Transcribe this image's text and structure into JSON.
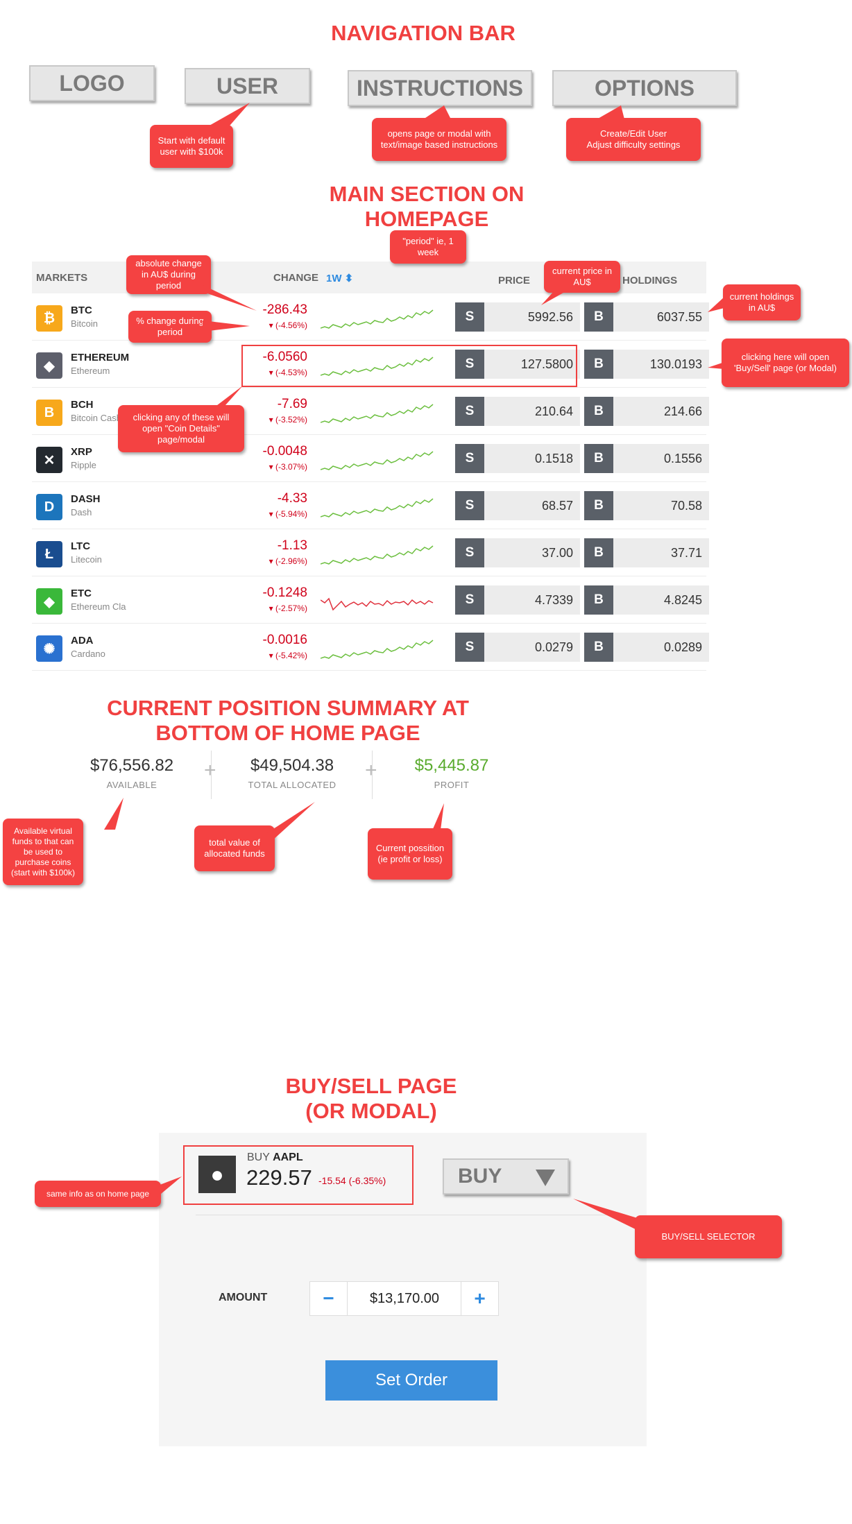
{
  "headings": {
    "nav": "NAVIGATION BAR",
    "main": "MAIN SECTION ON\nHOMEPAGE",
    "summary": "CURRENT POSITION SUMMARY AT\nBOTTOM OF HOME PAGE",
    "buysell": "BUY/SELL PAGE\n(OR MODAL)"
  },
  "nav": {
    "logo": "LOGO",
    "user": "USER",
    "instructions": "INSTRUCTIONS",
    "options": "OPTIONS"
  },
  "callouts": {
    "user": "Start with default\nuser with $100k",
    "instructions": "opens page or modal with\ntext/image based instructions",
    "options": "Create/Edit User\nAdjust difficulty settings",
    "period": "\"period\" ie, 1\nweek",
    "abs_change": "absolute change\nin AU$ during\nperiod",
    "pct_change": "% change during\nperiod",
    "price": "current price in\nAU$",
    "holdings": "current holdings\nin AU$",
    "buy_sell_link": "clicking here will open\n'Buy/Sell' page (or Modal)",
    "coin_details": "clicking any of these will\nopen \"Coin Details\"\npage/modal",
    "available": "Available virtual\nfunds to that can\nbe used to\npurchase coins\n(start with $100k)",
    "allocated": "total value of\nallocated funds",
    "profit": "Current possition\n(ie profit or loss)",
    "same_info": "same info as on home page",
    "selector": "BUY/SELL SELECTOR"
  },
  "table": {
    "headers": {
      "markets": "MARKETS",
      "change": "CHANGE",
      "period": "1W",
      "price": "PRICE",
      "holdings": "HOLDINGS"
    },
    "sell_label": "S",
    "buy_label": "B",
    "rows": [
      {
        "symbol": "BTC",
        "name": "Bitcoin",
        "change": "-286.43",
        "pct": "(-4.56%)",
        "price": "5992.56",
        "holdings": "6037.55",
        "icon": "bitcoin-icon",
        "icon_glyph": "₿",
        "icon_color": "#f7a81b",
        "trend": "up"
      },
      {
        "symbol": "ETHEREUM",
        "name": "Ethereum",
        "change": "-6.0560",
        "pct": "(-4.53%)",
        "price": "127.5800",
        "holdings": "130.0193",
        "icon": "ethereum-icon",
        "icon_glyph": "◆",
        "icon_color": "#5d5f6b",
        "trend": "up"
      },
      {
        "symbol": "BCH",
        "name": "Bitcoin Cash",
        "change": "-7.69",
        "pct": "(-3.52%)",
        "price": "210.64",
        "holdings": "214.66",
        "icon": "bitcoin-cash-icon",
        "icon_glyph": "B",
        "icon_color": "#f7a81b",
        "trend": "up"
      },
      {
        "symbol": "XRP",
        "name": "Ripple",
        "change": "-0.0048",
        "pct": "(-3.07%)",
        "price": "0.1518",
        "holdings": "0.1556",
        "icon": "ripple-icon",
        "icon_glyph": "✕",
        "icon_color": "#23292f",
        "trend": "up"
      },
      {
        "symbol": "DASH",
        "name": "Dash",
        "change": "-4.33",
        "pct": "(-5.94%)",
        "price": "68.57",
        "holdings": "70.58",
        "icon": "dash-icon",
        "icon_glyph": "D",
        "icon_color": "#1c75bc",
        "trend": "up"
      },
      {
        "symbol": "LTC",
        "name": "Litecoin",
        "change": "-1.13",
        "pct": "(-2.96%)",
        "price": "37.00",
        "holdings": "37.71",
        "icon": "litecoin-icon",
        "icon_glyph": "Ł",
        "icon_color": "#1a4d8f",
        "trend": "up"
      },
      {
        "symbol": "ETC",
        "name": "Ethereum Classic",
        "change": "-0.1248",
        "pct": "(-2.57%)",
        "price": "4.7339",
        "holdings": "4.8245",
        "icon": "ethereum-classic-icon",
        "icon_glyph": "◆",
        "icon_color": "#3ab83a",
        "trend": "down"
      },
      {
        "symbol": "ADA",
        "name": "Cardano",
        "change": "-0.0016",
        "pct": "(-5.42%)",
        "price": "0.0279",
        "holdings": "0.0289",
        "icon": "cardano-icon",
        "icon_glyph": "✺",
        "icon_color": "#2a71d0",
        "trend": "up"
      }
    ]
  },
  "summary": {
    "available_value": "$76,556.82",
    "available_label": "AVAILABLE",
    "allocated_value": "$49,504.38",
    "allocated_label": "TOTAL ALLOCATED",
    "profit_value": "$5,445.87",
    "profit_label": "PROFIT"
  },
  "buysell": {
    "action_prefix": "BUY",
    "ticker": "AAPL",
    "price": "229.57",
    "change": "-15.54 (-6.35%)",
    "selector_value": "BUY",
    "amount_label": "AMOUNT",
    "amount_value": "$13,170.00",
    "minus": "−",
    "plus": "+",
    "submit": "Set Order"
  },
  "colors": {
    "accent_red": "#f44242",
    "negative": "#d0021b",
    "positive": "#5aab2e",
    "link_blue": "#2f8be0",
    "button_blue": "#3b8fdc"
  }
}
